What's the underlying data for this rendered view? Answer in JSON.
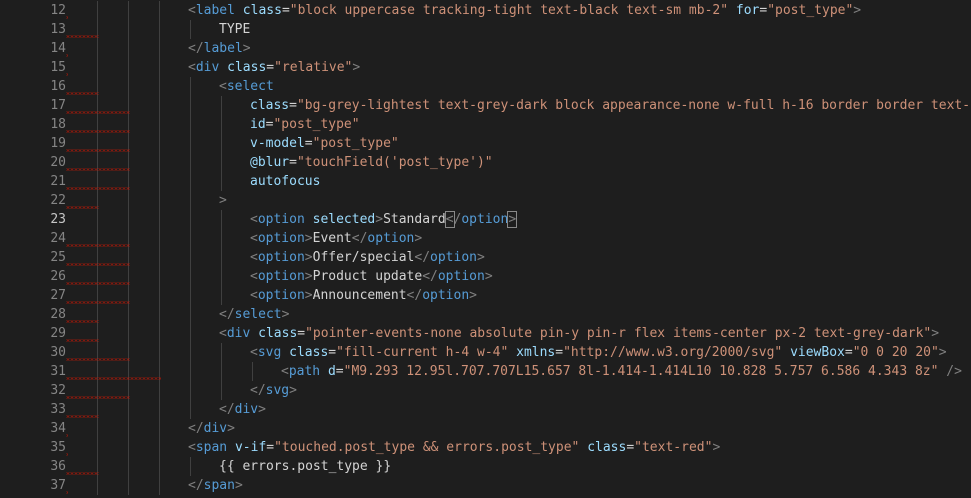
{
  "editor": {
    "current_line": 23,
    "lines": [
      {
        "num": "12",
        "indent": 4,
        "sq": true,
        "tokens": [
          [
            "t",
            "<"
          ],
          [
            "n",
            "label"
          ],
          [
            "x",
            " "
          ],
          [
            "a",
            "class"
          ],
          [
            "x",
            "="
          ],
          [
            "s",
            "\"block uppercase tracking-tight text-black text-sm mb-2\""
          ],
          [
            "x",
            " "
          ],
          [
            "a",
            "for"
          ],
          [
            "x",
            "="
          ],
          [
            "s",
            "\"post_type\""
          ],
          [
            "t",
            ">"
          ]
        ]
      },
      {
        "num": "13",
        "indent": 5,
        "sq": true,
        "tokens": [
          [
            "x",
            "TYPE"
          ]
        ]
      },
      {
        "num": "14",
        "indent": 4,
        "sq": true,
        "tokens": [
          [
            "t",
            "</"
          ],
          [
            "n",
            "label"
          ],
          [
            "t",
            ">"
          ]
        ]
      },
      {
        "num": "15",
        "indent": 4,
        "sq": true,
        "tokens": [
          [
            "t",
            "<"
          ],
          [
            "n",
            "div"
          ],
          [
            "x",
            " "
          ],
          [
            "a",
            "class"
          ],
          [
            "x",
            "="
          ],
          [
            "s",
            "\"relative\""
          ],
          [
            "t",
            ">"
          ]
        ]
      },
      {
        "num": "16",
        "indent": 5,
        "sq": true,
        "tokens": [
          [
            "t",
            "<"
          ],
          [
            "n",
            "select"
          ]
        ]
      },
      {
        "num": "17",
        "indent": 6,
        "sq": true,
        "tokens": [
          [
            "a",
            "class"
          ],
          [
            "x",
            "="
          ],
          [
            "s",
            "\"bg-grey-lightest text-grey-dark block appearance-none w-full h-16 border border text-bl"
          ]
        ]
      },
      {
        "num": "18",
        "indent": 6,
        "sq": true,
        "tokens": [
          [
            "a",
            "id"
          ],
          [
            "x",
            "="
          ],
          [
            "s",
            "\"post_type\""
          ]
        ]
      },
      {
        "num": "19",
        "indent": 6,
        "sq": true,
        "tokens": [
          [
            "a",
            "v-model"
          ],
          [
            "x",
            "="
          ],
          [
            "s",
            "\"post_type\""
          ]
        ]
      },
      {
        "num": "20",
        "indent": 6,
        "sq": true,
        "tokens": [
          [
            "a",
            "@blur"
          ],
          [
            "x",
            "="
          ],
          [
            "s",
            "\"touchField('post_type')\""
          ]
        ]
      },
      {
        "num": "21",
        "indent": 6,
        "sq": true,
        "tokens": [
          [
            "a",
            "autofocus"
          ]
        ]
      },
      {
        "num": "22",
        "indent": 5,
        "sq": true,
        "tokens": [
          [
            "t",
            ">"
          ]
        ]
      },
      {
        "num": "23",
        "indent": 6,
        "sq": false,
        "tokens": [
          [
            "t",
            "<"
          ],
          [
            "n",
            "option"
          ],
          [
            "x",
            " "
          ],
          [
            "a",
            "selected"
          ],
          [
            "t",
            ">"
          ],
          [
            "x",
            "Standard"
          ],
          [
            "c",
            "<"
          ],
          [
            "t",
            "/"
          ],
          [
            "n",
            "option"
          ],
          [
            "c",
            ">"
          ]
        ]
      },
      {
        "num": "24",
        "indent": 6,
        "sq": true,
        "tokens": [
          [
            "t",
            "<"
          ],
          [
            "n",
            "option"
          ],
          [
            "t",
            ">"
          ],
          [
            "x",
            "Event"
          ],
          [
            "t",
            "</"
          ],
          [
            "n",
            "option"
          ],
          [
            "t",
            ">"
          ]
        ]
      },
      {
        "num": "25",
        "indent": 6,
        "sq": true,
        "tokens": [
          [
            "t",
            "<"
          ],
          [
            "n",
            "option"
          ],
          [
            "t",
            ">"
          ],
          [
            "x",
            "Offer/special"
          ],
          [
            "t",
            "</"
          ],
          [
            "n",
            "option"
          ],
          [
            "t",
            ">"
          ]
        ]
      },
      {
        "num": "26",
        "indent": 6,
        "sq": true,
        "tokens": [
          [
            "t",
            "<"
          ],
          [
            "n",
            "option"
          ],
          [
            "t",
            ">"
          ],
          [
            "x",
            "Product update"
          ],
          [
            "t",
            "</"
          ],
          [
            "n",
            "option"
          ],
          [
            "t",
            ">"
          ]
        ]
      },
      {
        "num": "27",
        "indent": 6,
        "sq": true,
        "tokens": [
          [
            "t",
            "<"
          ],
          [
            "n",
            "option"
          ],
          [
            "t",
            ">"
          ],
          [
            "x",
            "Announcement"
          ],
          [
            "t",
            "</"
          ],
          [
            "n",
            "option"
          ],
          [
            "t",
            ">"
          ]
        ]
      },
      {
        "num": "28",
        "indent": 5,
        "sq": true,
        "tokens": [
          [
            "t",
            "</"
          ],
          [
            "n",
            "select"
          ],
          [
            "t",
            ">"
          ]
        ]
      },
      {
        "num": "29",
        "indent": 5,
        "sq": true,
        "tokens": [
          [
            "t",
            "<"
          ],
          [
            "n",
            "div"
          ],
          [
            "x",
            " "
          ],
          [
            "a",
            "class"
          ],
          [
            "x",
            "="
          ],
          [
            "s",
            "\"pointer-events-none absolute pin-y pin-r flex items-center px-2 text-grey-dark\""
          ],
          [
            "t",
            ">"
          ]
        ]
      },
      {
        "num": "30",
        "indent": 6,
        "sq": true,
        "tokens": [
          [
            "t",
            "<"
          ],
          [
            "n",
            "svg"
          ],
          [
            "x",
            " "
          ],
          [
            "a",
            "class"
          ],
          [
            "x",
            "="
          ],
          [
            "s",
            "\"fill-current h-4 w-4\""
          ],
          [
            "x",
            " "
          ],
          [
            "a",
            "xmlns"
          ],
          [
            "x",
            "="
          ],
          [
            "s",
            "\"http://www.w3.org/2000/svg\""
          ],
          [
            "x",
            " "
          ],
          [
            "a",
            "viewBox"
          ],
          [
            "x",
            "="
          ],
          [
            "s",
            "\"0 0 20 20\""
          ],
          [
            "t",
            ">"
          ]
        ]
      },
      {
        "num": "31",
        "indent": 7,
        "sq": true,
        "tokens": [
          [
            "t",
            "<"
          ],
          [
            "n",
            "path"
          ],
          [
            "x",
            " "
          ],
          [
            "a",
            "d"
          ],
          [
            "x",
            "="
          ],
          [
            "s",
            "\"M9.293 12.95l.707.707L15.657 8l-1.414-1.414L10 10.828 5.757 6.586 4.343 8z\""
          ],
          [
            "x",
            " "
          ],
          [
            "t",
            "/>"
          ]
        ]
      },
      {
        "num": "32",
        "indent": 6,
        "sq": true,
        "tokens": [
          [
            "t",
            "</"
          ],
          [
            "n",
            "svg"
          ],
          [
            "t",
            ">"
          ]
        ]
      },
      {
        "num": "33",
        "indent": 5,
        "sq": true,
        "tokens": [
          [
            "t",
            "</"
          ],
          [
            "n",
            "div"
          ],
          [
            "t",
            ">"
          ]
        ]
      },
      {
        "num": "34",
        "indent": 4,
        "sq": true,
        "tokens": [
          [
            "t",
            "</"
          ],
          [
            "n",
            "div"
          ],
          [
            "t",
            ">"
          ]
        ]
      },
      {
        "num": "35",
        "indent": 4,
        "sq": true,
        "tokens": [
          [
            "t",
            "<"
          ],
          [
            "n",
            "span"
          ],
          [
            "x",
            " "
          ],
          [
            "a",
            "v-if"
          ],
          [
            "x",
            "="
          ],
          [
            "s",
            "\"touched.post_type && errors.post_type\""
          ],
          [
            "x",
            " "
          ],
          [
            "a",
            "class"
          ],
          [
            "x",
            "="
          ],
          [
            "s",
            "\"text-red\""
          ],
          [
            "t",
            ">"
          ]
        ]
      },
      {
        "num": "36",
        "indent": 5,
        "sq": true,
        "tokens": [
          [
            "x",
            "{{ errors.post_type }}"
          ]
        ]
      },
      {
        "num": "37",
        "indent": 4,
        "sq": true,
        "tokens": [
          [
            "t",
            "</"
          ],
          [
            "n",
            "span"
          ],
          [
            "t",
            ">"
          ]
        ]
      }
    ]
  }
}
